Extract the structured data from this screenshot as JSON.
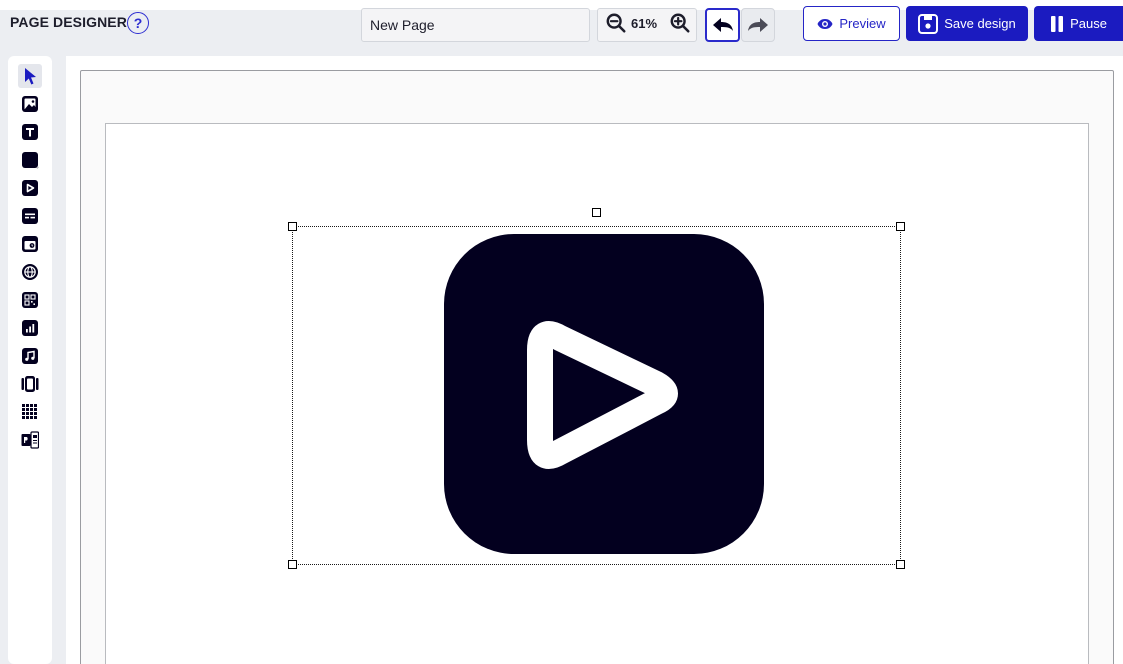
{
  "header": {
    "title": "PAGE DESIGNER",
    "help_symbol": "?",
    "page_name_value": "New Page",
    "zoom_level": "61%",
    "preview_label": "Preview",
    "save_label": "Save design",
    "pause_label": "Pause"
  },
  "toolbox": {
    "tools": [
      {
        "icon": "pointer-icon",
        "active": true
      },
      {
        "icon": "image-icon"
      },
      {
        "icon": "text-icon"
      },
      {
        "icon": "shape-icon"
      },
      {
        "icon": "video-icon"
      },
      {
        "icon": "ticker-icon"
      },
      {
        "icon": "calendar-icon"
      },
      {
        "icon": "web-icon"
      },
      {
        "icon": "qr-code-icon"
      },
      {
        "icon": "chart-icon"
      },
      {
        "icon": "audio-icon"
      },
      {
        "icon": "carousel-icon"
      },
      {
        "icon": "grid-icon"
      },
      {
        "icon": "powerpoint-icon"
      }
    ]
  },
  "canvas": {
    "selected_element": "video-icon"
  },
  "colors": {
    "accent": "#1b1bc0",
    "icon_dark": "#03001f",
    "background": "#eceef2"
  }
}
